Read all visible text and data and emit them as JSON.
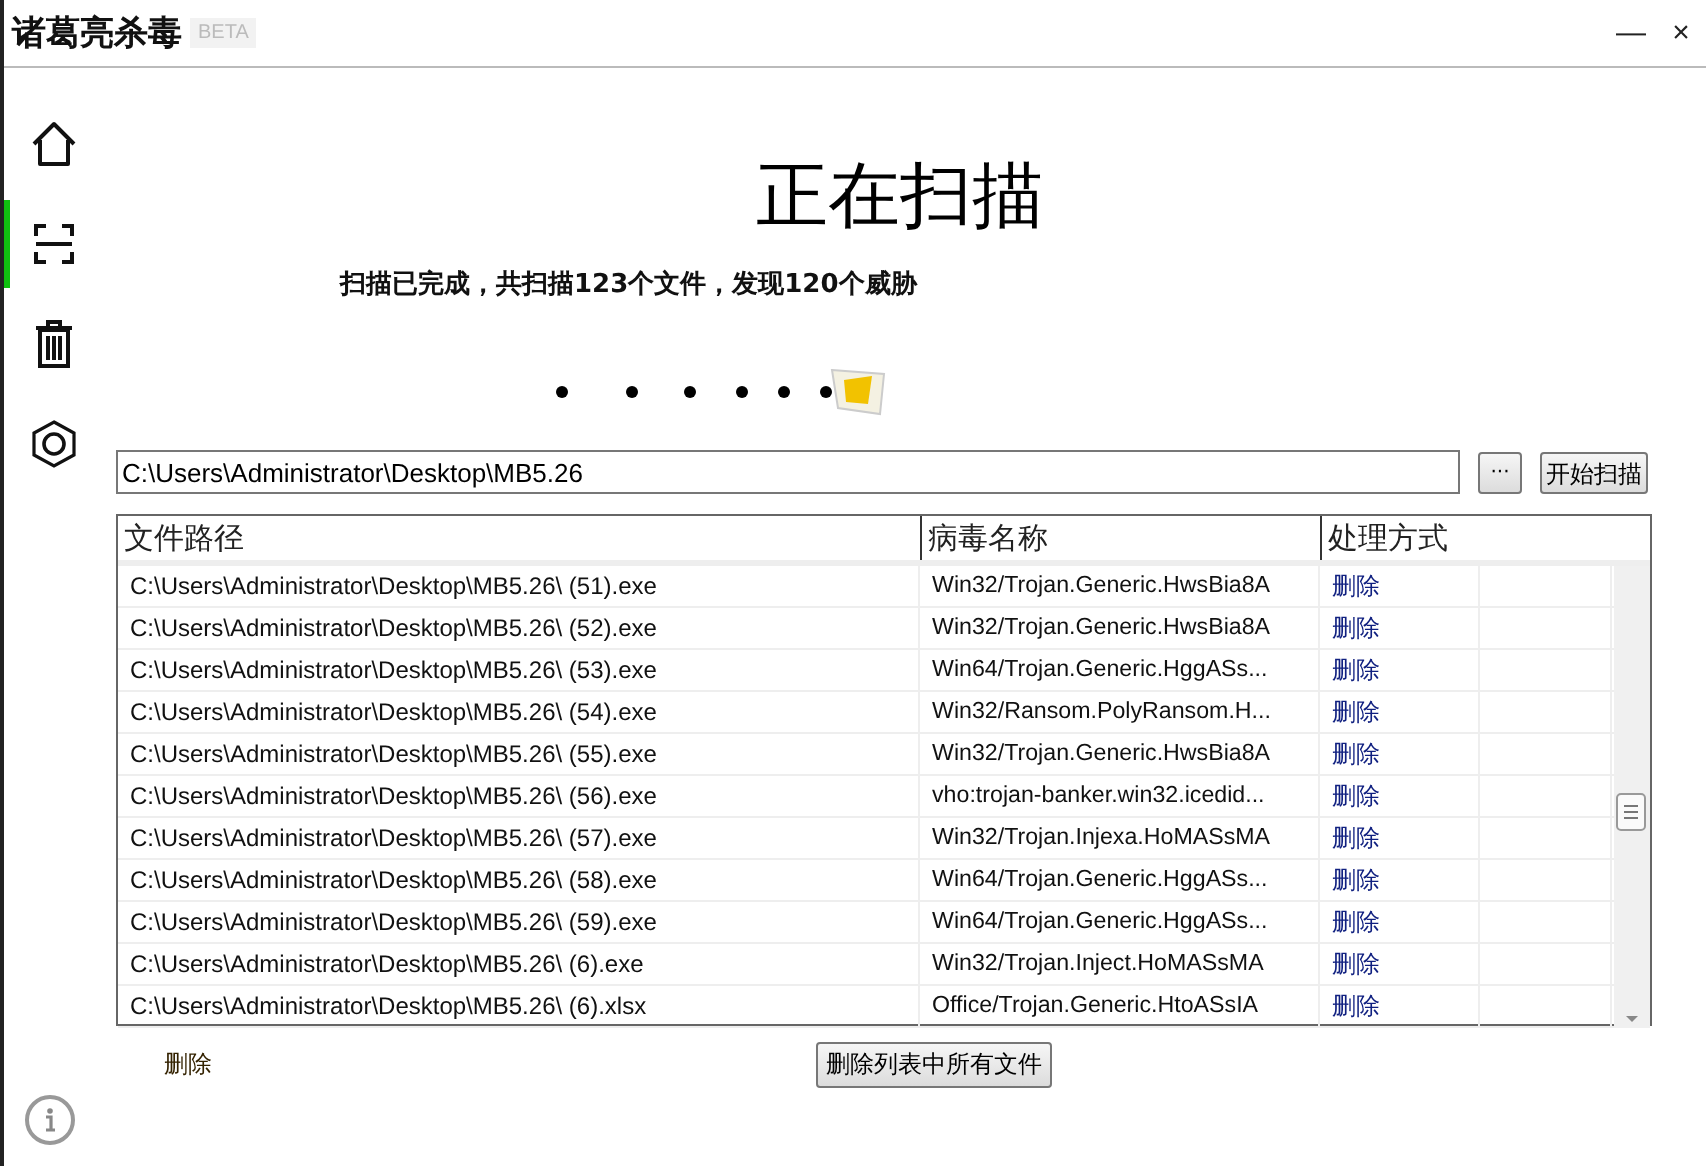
{
  "window": {
    "title": "诸葛亮杀毒",
    "badge": "BETA",
    "controls": [
      "—",
      "×"
    ]
  },
  "sidebar": {
    "items": [
      {
        "kind": "home",
        "selected": false
      },
      {
        "kind": "scan",
        "selected": true
      },
      {
        "kind": "trash",
        "selected": false
      },
      {
        "kind": "settings",
        "selected": false
      }
    ],
    "footer": {
      "kind": "info"
    }
  },
  "heading": "正在扫描",
  "status": "扫描已完成，共扫描123个文件，发现120个威胁",
  "path_field": {
    "value": "C:\\Users\\Administrator\\Desktop\\MB5.26"
  },
  "browse_button": "···",
  "start_button": "开始扫描",
  "table": {
    "columns": [
      "文件路径",
      "病毒名称",
      "处理方式"
    ],
    "rows": [
      {
        "path": "C:\\Users\\Administrator\\Desktop\\MB5.26\\ (51).exe",
        "virus": "Win32/Trojan.Generic.HwsBia8A",
        "action": "删除"
      },
      {
        "path": "C:\\Users\\Administrator\\Desktop\\MB5.26\\ (52).exe",
        "virus": "Win32/Trojan.Generic.HwsBia8A",
        "action": "删除"
      },
      {
        "path": "C:\\Users\\Administrator\\Desktop\\MB5.26\\ (53).exe",
        "virus": "Win64/Trojan.Generic.HggASs...",
        "action": "删除"
      },
      {
        "path": "C:\\Users\\Administrator\\Desktop\\MB5.26\\ (54).exe",
        "virus": "Win32/Ransom.PolyRansom.H...",
        "action": "删除"
      },
      {
        "path": "C:\\Users\\Administrator\\Desktop\\MB5.26\\ (55).exe",
        "virus": "Win32/Trojan.Generic.HwsBia8A",
        "action": "删除"
      },
      {
        "path": "C:\\Users\\Administrator\\Desktop\\MB5.26\\ (56).exe",
        "virus": "vho:trojan-banker.win32.icedid...",
        "action": "删除"
      },
      {
        "path": "C:\\Users\\Administrator\\Desktop\\MB5.26\\ (57).exe",
        "virus": "Win32/Trojan.Injexa.HoMASsMA",
        "action": "删除"
      },
      {
        "path": "C:\\Users\\Administrator\\Desktop\\MB5.26\\ (58).exe",
        "virus": "Win64/Trojan.Generic.HggASs...",
        "action": "删除"
      },
      {
        "path": "C:\\Users\\Administrator\\Desktop\\MB5.26\\ (59).exe",
        "virus": "Win64/Trojan.Generic.HggASs...",
        "action": "删除"
      },
      {
        "path": "C:\\Users\\Administrator\\Desktop\\MB5.26\\ (6).exe",
        "virus": "Win32/Trojan.Inject.HoMASsMA",
        "action": "删除"
      },
      {
        "path": "C:\\Users\\Administrator\\Desktop\\MB5.26\\ (6).xlsx",
        "virus": "Office/Trojan.Generic.HtoASsIA",
        "action": "删除"
      }
    ]
  },
  "footer": {
    "delete_link": "删除",
    "delete_all_button": "删除列表中所有文件"
  }
}
